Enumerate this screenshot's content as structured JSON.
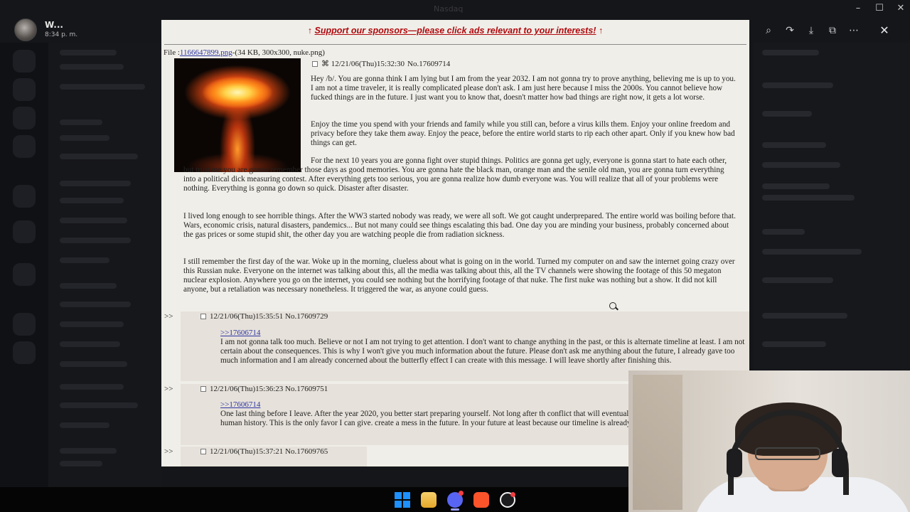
{
  "discord": {
    "user_name": "W...",
    "user_time": "8:34 p. m.",
    "window_title": "Nasdaq"
  },
  "viewer": {
    "icons": [
      "zoom-in-icon",
      "forward-icon",
      "download-icon",
      "open-external-icon",
      "more-icon",
      "close-icon"
    ]
  },
  "post": {
    "sponsor_text": "Support our sponsors—please click ads relevant to your interests!",
    "file_label": "File :",
    "file_name": "1166647899.png",
    "file_meta": "-(34 KB, 300x300, nuke.png)",
    "op_datetime": "12/21/06(Thu)15:32:30",
    "op_number": "No.17609714",
    "paragraphs": [
      "Hey /b/. You are gonna think I am lying but I am from the year 2032. I am not gonna try to prove anything, believing me is up to you. I am not a time traveler, it is really complicated please don't ask. I am just here because I miss the 2000s. You cannot believe how fucked things are in the future. I just want you to know that, doesn't matter how bad things are right now, it gets a lot worse.",
      "Enjoy the time you spend with your friends and family while you still can, before a virus kills them. Enjoy your online freedom and privacy before they take them away. Enjoy the peace, before the entire world starts to rip each other apart. Only if you knew how bad things can get.",
      "For the next 10 years you are gonna fight over stupid things. Politics are gonna get ugly, everyone is gonna start to hate each other, but trust me you are gonna remember those days as good memories. You are gonna hate the black man, orange man and the senile old man, you are gonna turn everything into a political dick measuring contest. After everything gets too serious, you are gonna realize how dumb everyone was. You will realize that all of your problems were nothing. Everything is gonna go down so quick. Disaster after disaster.",
      "I lived long enough to see horrible things. After the WW3 started nobody was ready, we were all soft. We got caught underprepared. The entire world was boiling before that. Wars, economic crisis, natural disasters, pandemics... But not many could see things escalating this bad. One day you are minding your business, probably concerned about the gas prices or some stupid shit, the other day you are watching people die from radiation sickness.",
      "I still remember the first day of the war. Woke up in the morning, clueless about what is going on in the world. Turned my computer on and saw the internet going crazy over this Russian nuke. Everyone on the internet was talking about this, all the media was talking about this, all the TV channels were showing the footage of this 50 megaton nuclear explosion. Anywhere you go on the internet, you could see nothing but the horrifying footage of that nuke. The first nuke was nothing but a show. It did not kill anyone, but a retaliation was necessary nonetheless. It triggered the war, as anyone could guess."
    ],
    "replies": [
      {
        "arrow": ">>",
        "datetime": "12/21/06(Thu)15:35:51",
        "number": "No.17609729",
        "quote": ">>17606714",
        "text": "I am not gonna talk too much. Believe or not I am not trying to get attention. I don't want to change anything in the past, or this is alternate timeline at least. I am not certain about the consequences. This is why I won't give you much information about the future. Please don't ask me anything about the future, I already gave too much information and I am already concerned about the butterfly effect I can create with this message. I will leave shortly after finishing this."
      },
      {
        "arrow": ">>",
        "datetime": "12/21/06(Thu)15:36:23",
        "number": "No.17609751",
        "quote": ">>17606714",
        "text": "One last thing before I leave. After the year 2020, you better start preparing yourself. Not long after th conflict that will eventually turn into the biggest war in human history. This is the only favor I can give. create a mess in the future. In your future at least because our timeline is already fucked."
      },
      {
        "arrow": ">>",
        "datetime": "12/21/06(Thu)15:37:21",
        "number": "No.17609765"
      }
    ]
  },
  "taskbar": {
    "icons": [
      "windows-start-icon",
      "file-explorer-icon",
      "discord-icon",
      "brave-browser-icon",
      "app-icon"
    ]
  }
}
